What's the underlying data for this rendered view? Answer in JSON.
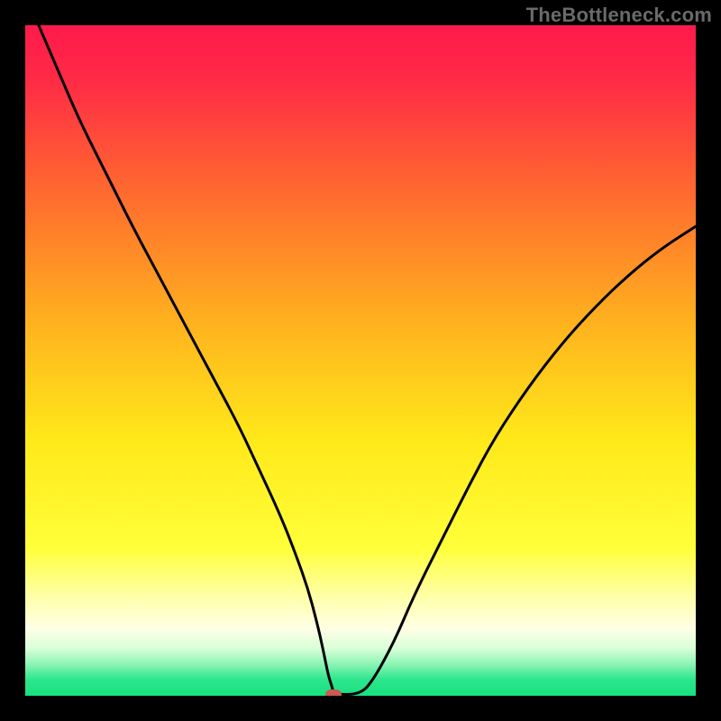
{
  "watermark": "TheBottleneck.com",
  "chart_data": {
    "type": "line",
    "title": "",
    "xlabel": "",
    "ylabel": "",
    "xlim": [
      0,
      100
    ],
    "ylim": [
      0,
      100
    ],
    "gradient_stops": [
      {
        "offset": 0.0,
        "color": "#ff1a4b"
      },
      {
        "offset": 0.08,
        "color": "#ff2a46"
      },
      {
        "offset": 0.25,
        "color": "#ff6a2f"
      },
      {
        "offset": 0.45,
        "color": "#ffb41e"
      },
      {
        "offset": 0.62,
        "color": "#ffe91a"
      },
      {
        "offset": 0.78,
        "color": "#ffff3a"
      },
      {
        "offset": 0.85,
        "color": "#ffffa6"
      },
      {
        "offset": 0.9,
        "color": "#ffffe6"
      },
      {
        "offset": 0.93,
        "color": "#d8ffd8"
      },
      {
        "offset": 0.955,
        "color": "#85f3b0"
      },
      {
        "offset": 0.975,
        "color": "#2ee68e"
      },
      {
        "offset": 1.0,
        "color": "#18e07e"
      }
    ],
    "series": [
      {
        "name": "bottleneck-curve",
        "x": [
          2,
          5,
          8,
          12,
          16,
          20,
          24,
          28,
          32,
          35,
          38,
          40,
          42,
          43.5,
          44.5,
          45.2,
          45.8,
          46,
          50,
          52,
          55,
          58,
          62,
          66,
          70,
          75,
          80,
          85,
          90,
          95,
          100
        ],
        "y": [
          100,
          93,
          86,
          78,
          70,
          62.5,
          55,
          47.5,
          40,
          33.5,
          27,
          22,
          16.5,
          11,
          6.5,
          3,
          1.2,
          0.2,
          0.2,
          2.5,
          8,
          15,
          23,
          31,
          38.5,
          46,
          52.5,
          58,
          62.8,
          66.8,
          70
        ]
      }
    ],
    "marker": {
      "x": 46,
      "y": 0.2,
      "color": "#c95a54"
    }
  }
}
